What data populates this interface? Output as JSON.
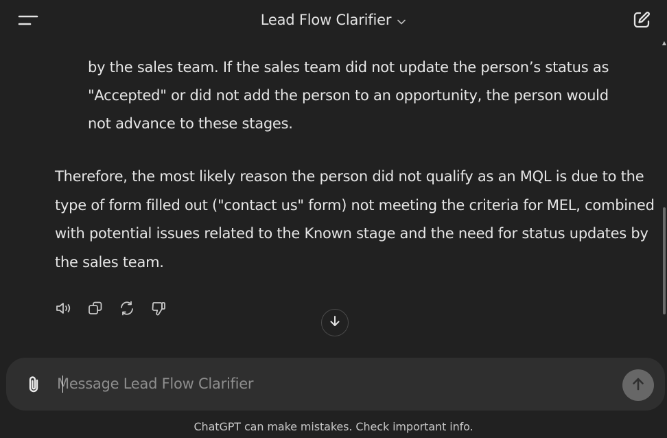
{
  "header": {
    "title": "Lead Flow Clarifier",
    "menu_icon": "hamburger-menu-icon",
    "new_chat_icon": "compose-icon"
  },
  "message": {
    "clipped_lines": [
      "by the sales team. If the sales team did not update the person’s status as",
      "\"Accepted\" or did not add the person to an opportunity, the person would",
      "not advance to these stages."
    ],
    "conclusion": "Therefore, the most likely reason the person did not qualify as an MQL is due to the type of form filled out (\"contact us\" form) not meeting the criteria for MEL, combined with potential issues related to the Known stage and the need for status updates by the sales team.",
    "actions": [
      "read-aloud-icon",
      "copy-icon",
      "regenerate-icon",
      "thumbs-down-icon"
    ]
  },
  "composer": {
    "placeholder": "Message Lead Flow Clarifier",
    "value": ""
  },
  "footer": {
    "disclaimer": "ChatGPT can make mistakes. Check important info."
  },
  "colors": {
    "background": "#212121",
    "composer": "#2f2f2f",
    "send_button": "#676767"
  }
}
